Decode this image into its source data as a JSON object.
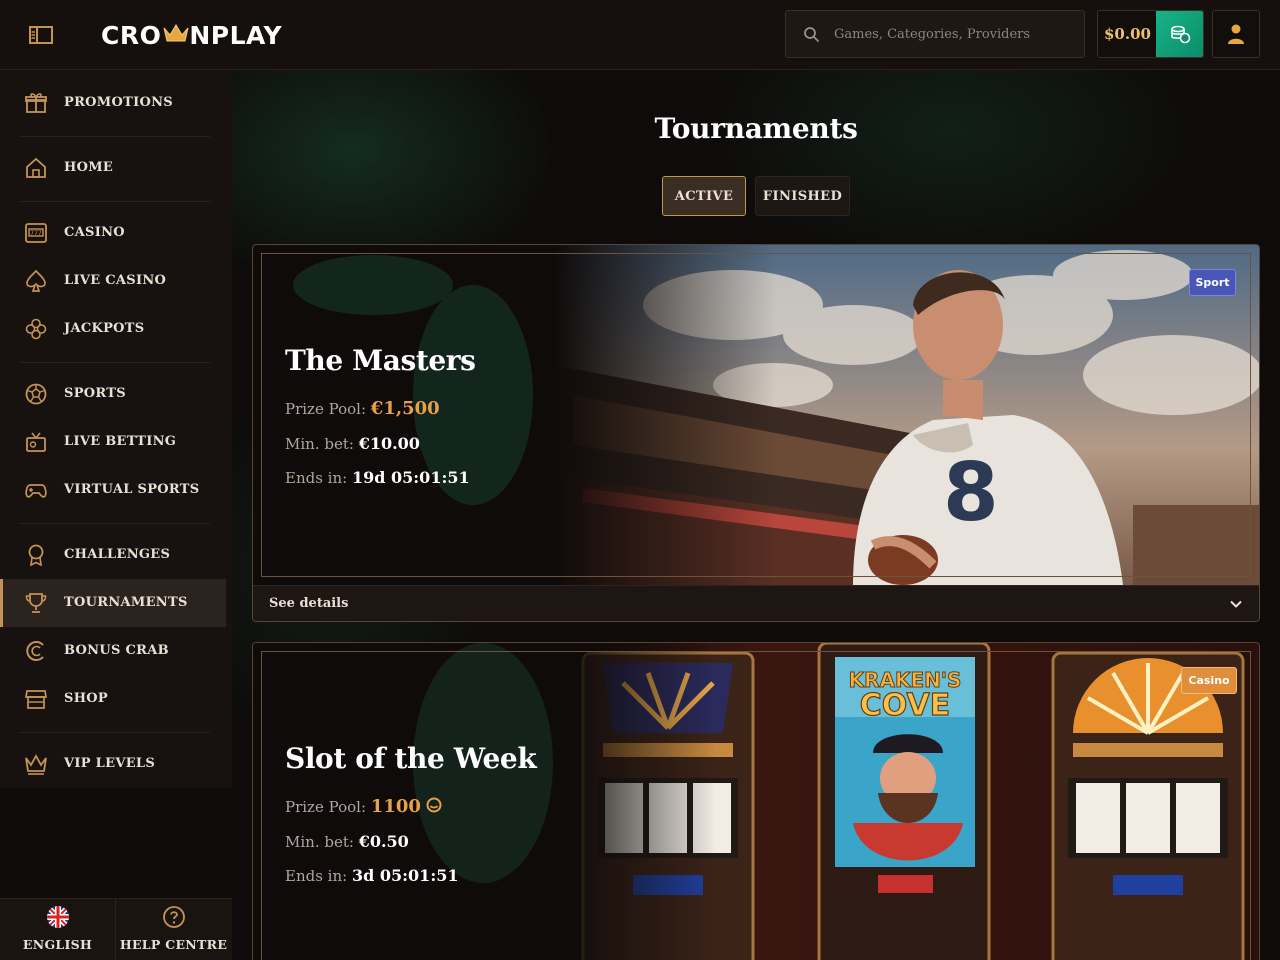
{
  "header": {
    "logo_text_left": "CRO",
    "logo_text_right": "NPLAY",
    "search_placeholder": "Games, Categories, Providers",
    "balance": "$0.00"
  },
  "sidebar": {
    "items": [
      {
        "label": "PROMOTIONS",
        "icon": "gift-icon"
      },
      {
        "label": "HOME",
        "icon": "home-icon"
      },
      {
        "label": "CASINO",
        "icon": "slot-machine-icon"
      },
      {
        "label": "LIVE CASINO",
        "icon": "spade-icon"
      },
      {
        "label": "JACKPOTS",
        "icon": "clover-icon"
      },
      {
        "label": "SPORTS",
        "icon": "soccer-ball-icon"
      },
      {
        "label": "LIVE BETTING",
        "icon": "live-tv-icon"
      },
      {
        "label": "VIRTUAL SPORTS",
        "icon": "gamepad-icon"
      },
      {
        "label": "CHALLENGES",
        "icon": "medal-icon"
      },
      {
        "label": "TOURNAMENTS",
        "icon": "trophy-icon"
      },
      {
        "label": "BONUS CRAB",
        "icon": "crab-icon"
      },
      {
        "label": "SHOP",
        "icon": "shop-icon"
      },
      {
        "label": "VIP LEVELS",
        "icon": "crown-icon"
      }
    ],
    "active": "TOURNAMENTS",
    "language_label": "ENGLISH",
    "help_label": "HELP CENTRE"
  },
  "main": {
    "title": "Tournaments",
    "tabs": {
      "active": "ACTIVE",
      "finished": "FINISHED"
    },
    "tournaments": [
      {
        "title": "The Masters",
        "badge": "Sport",
        "badge_color": "#4a55b8",
        "prize_label": "Prize Pool:",
        "prize_value": "€1,500",
        "minbet_label": "Min. bet:",
        "minbet_value": "€10.00",
        "ends_label": "Ends in:",
        "ends_value": "19d 05:01:51",
        "details_label": "See details"
      },
      {
        "title": "Slot of the Week",
        "badge": "Casino",
        "badge_color": "#e08d3c",
        "prize_label": "Prize Pool:",
        "prize_value": "1100",
        "minbet_label": "Min. bet:",
        "minbet_value": "€0.50",
        "ends_label": "Ends in:",
        "ends_value": "3d 05:01:51",
        "slot_sign": "KRAKEN'S COVE"
      }
    ]
  },
  "colors": {
    "accent_gold": "#c49356",
    "prize_orange": "#e7a14a",
    "deposit_green": "#16b489"
  }
}
